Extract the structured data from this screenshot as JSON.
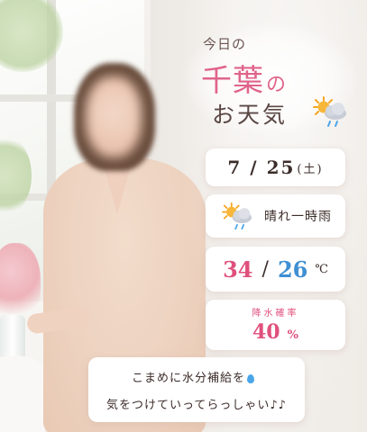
{
  "header": {
    "line1": "今日の",
    "city": "千葉",
    "city_suffix": "の",
    "line3": "お天気"
  },
  "date": {
    "value": "7 / 25",
    "dow": "(土)"
  },
  "forecast": {
    "icon": "sun-cloud-rain-icon",
    "text": "晴れ一時雨"
  },
  "temperature": {
    "high": "34",
    "separator": "/",
    "low": "26",
    "unit": "℃"
  },
  "rain": {
    "label": "降水確率",
    "value": "40",
    "unit": "%"
  },
  "message": {
    "line1": "こまめに水分補給を",
    "line2": "気をつけていってらっしゃい♪♪"
  },
  "colors": {
    "accent_pink": "#e0507c",
    "accent_blue": "#3f8fd3",
    "text_dark": "#3c2d2a"
  }
}
